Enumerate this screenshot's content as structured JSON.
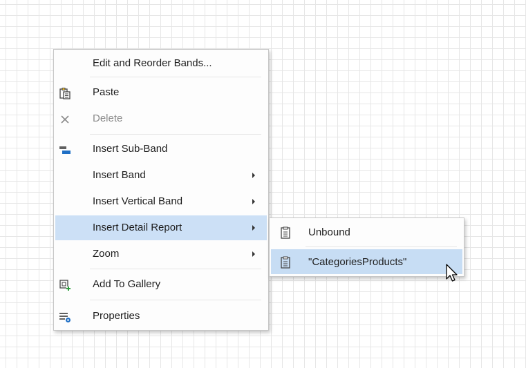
{
  "context_menu": {
    "items": [
      {
        "label": "Edit and Reorder Bands..."
      },
      {
        "label": "Paste",
        "icon": "paste-icon"
      },
      {
        "label": "Delete",
        "icon": "delete-icon",
        "disabled": true
      },
      {
        "label": "Insert Sub-Band",
        "icon": "insert-sub-band-icon"
      },
      {
        "label": "Insert Band",
        "has_submenu": true
      },
      {
        "label": "Insert Vertical Band",
        "has_submenu": true
      },
      {
        "label": "Insert Detail Report",
        "has_submenu": true,
        "highlighted": true
      },
      {
        "label": "Zoom",
        "has_submenu": true
      },
      {
        "label": "Add To Gallery",
        "icon": "add-to-gallery-icon"
      },
      {
        "label": "Properties",
        "icon": "properties-icon"
      }
    ]
  },
  "submenu": {
    "items": [
      {
        "label": "Unbound",
        "icon": "detail-report-icon"
      },
      {
        "label": "\"CategoriesProducts\"",
        "icon": "detail-report-icon",
        "highlighted": true
      }
    ]
  },
  "colors": {
    "highlight": "#cce0f6",
    "grid_line": "#e6e6e6",
    "accent_blue": "#1f6fc5",
    "disabled_text": "#8a8a8a"
  }
}
